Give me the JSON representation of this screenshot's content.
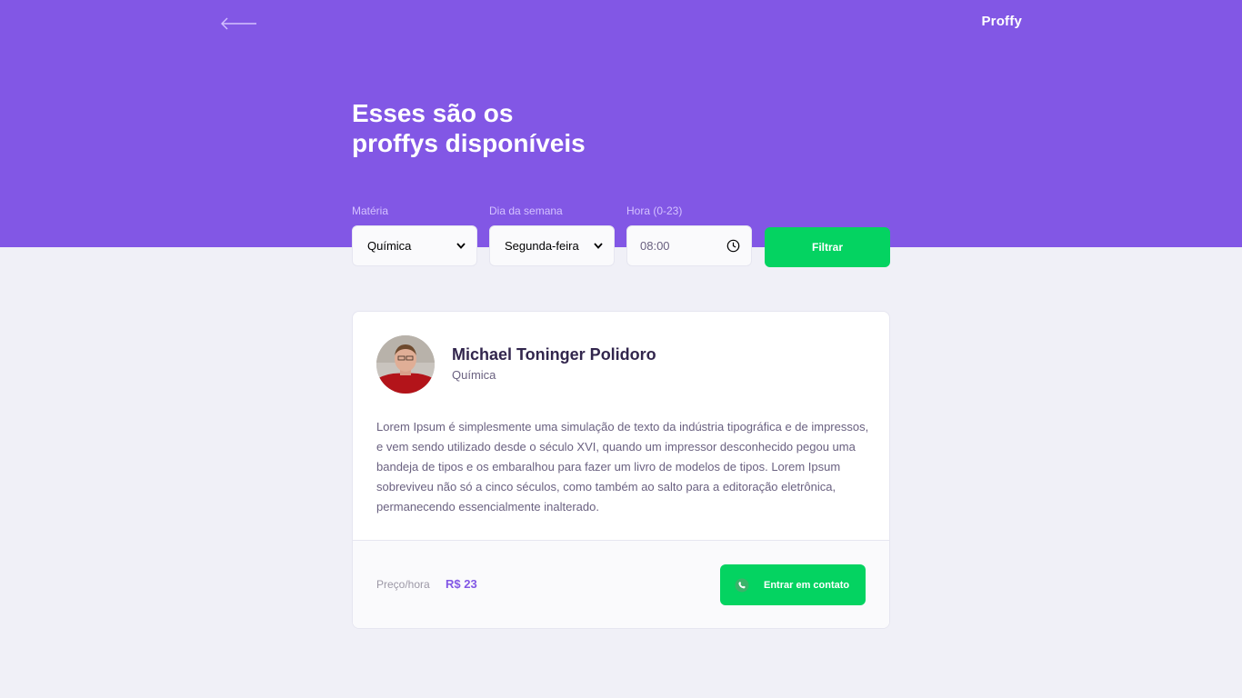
{
  "header": {
    "logo": "Proffy",
    "title_line1": "Esses são os",
    "title_line2": "proffys disponíveis"
  },
  "filters": {
    "subject": {
      "label": "Matéria",
      "value": "Química"
    },
    "weekday": {
      "label": "Dia da semana",
      "value": "Segunda-feira"
    },
    "time": {
      "label": "Hora (0-23)",
      "value": "08:00"
    },
    "submit_label": "Filtrar"
  },
  "teacher": {
    "name": "Michael Toninger Polidoro",
    "subject": "Química",
    "bio": "Lorem Ipsum é simplesmente uma simulação de texto da indústria tipográfica e de impressos, e vem sendo utilizado desde o século XVI, quando um impressor desconhecido pegou uma bandeja de tipos e os embaralhou para fazer um livro de modelos de tipos. Lorem Ipsum sobreviveu não só a cinco séculos, como também ao salto para a editoração eletrônica, permanecendo essencialmente inalterado.",
    "price_label": "Preço/hora",
    "price_value": "R$ 23",
    "contact_label": "Entrar em contato"
  },
  "icons": {
    "back": "arrow-left-icon",
    "clock": "clock-icon",
    "chevron": "chevron-down-icon",
    "whatsapp": "whatsapp-icon"
  },
  "colors": {
    "primary": "#8257E5",
    "secondary": "#04D361",
    "background": "#F0F0F7"
  }
}
